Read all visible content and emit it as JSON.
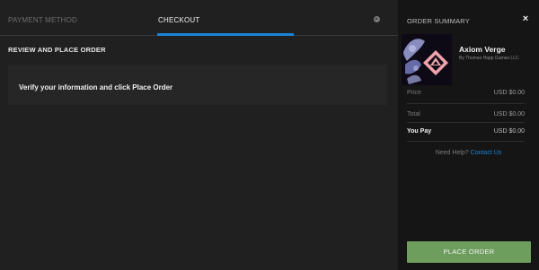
{
  "tabs": {
    "payment_method": "PAYMENT METHOD",
    "checkout": "CHECKOUT"
  },
  "review": {
    "title": "REVIEW AND PLACE ORDER",
    "verify_text": "Verify your information and click Place Order"
  },
  "summary": {
    "title": "ORDER SUMMARY",
    "close_icon": "×",
    "game": {
      "title": "Axiom Verge",
      "publisher": "By Thomas Happ Games LLC"
    },
    "rows": {
      "price_label": "Price",
      "price_value": "USD $0.00",
      "total_label": "Total",
      "total_value": "USD $0.00",
      "pay_label": "You Pay",
      "pay_value": "USD $0.00"
    },
    "help_text": "Need Help?",
    "contact_link": "Contact Us",
    "place_order": "PLACE ORDER"
  },
  "colors": {
    "accent": "#1a83d6",
    "button": "#6d9e5e"
  }
}
